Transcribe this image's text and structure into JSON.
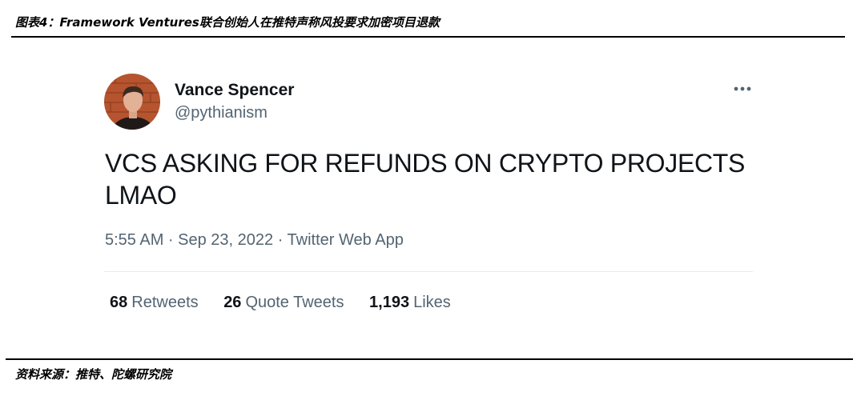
{
  "figure": {
    "title": "图表4：Framework Ventures联合创始人在推特声称风投要求加密项目退款",
    "source": "资料来源：推特、陀螺研究院"
  },
  "tweet": {
    "author_name": "Vance Spencer",
    "author_handle": "@pythianism",
    "text": "VCS ASKING FOR REFUNDS ON CRYPTO PROJECTS LMAO",
    "timestamp": "5:55 AM · Sep 23, 2022 · Twitter Web App",
    "more_icon": "more-horizontal-icon",
    "avatar_icon": "avatar",
    "stats": {
      "retweets_count": "68",
      "retweets_label": "Retweets",
      "quotes_count": "26",
      "quotes_label": "Quote Tweets",
      "likes_count": "1,193",
      "likes_label": "Likes"
    }
  },
  "colors": {
    "primary_text": "#0f1419",
    "secondary_text": "#536471",
    "divider": "#e8ecef"
  }
}
